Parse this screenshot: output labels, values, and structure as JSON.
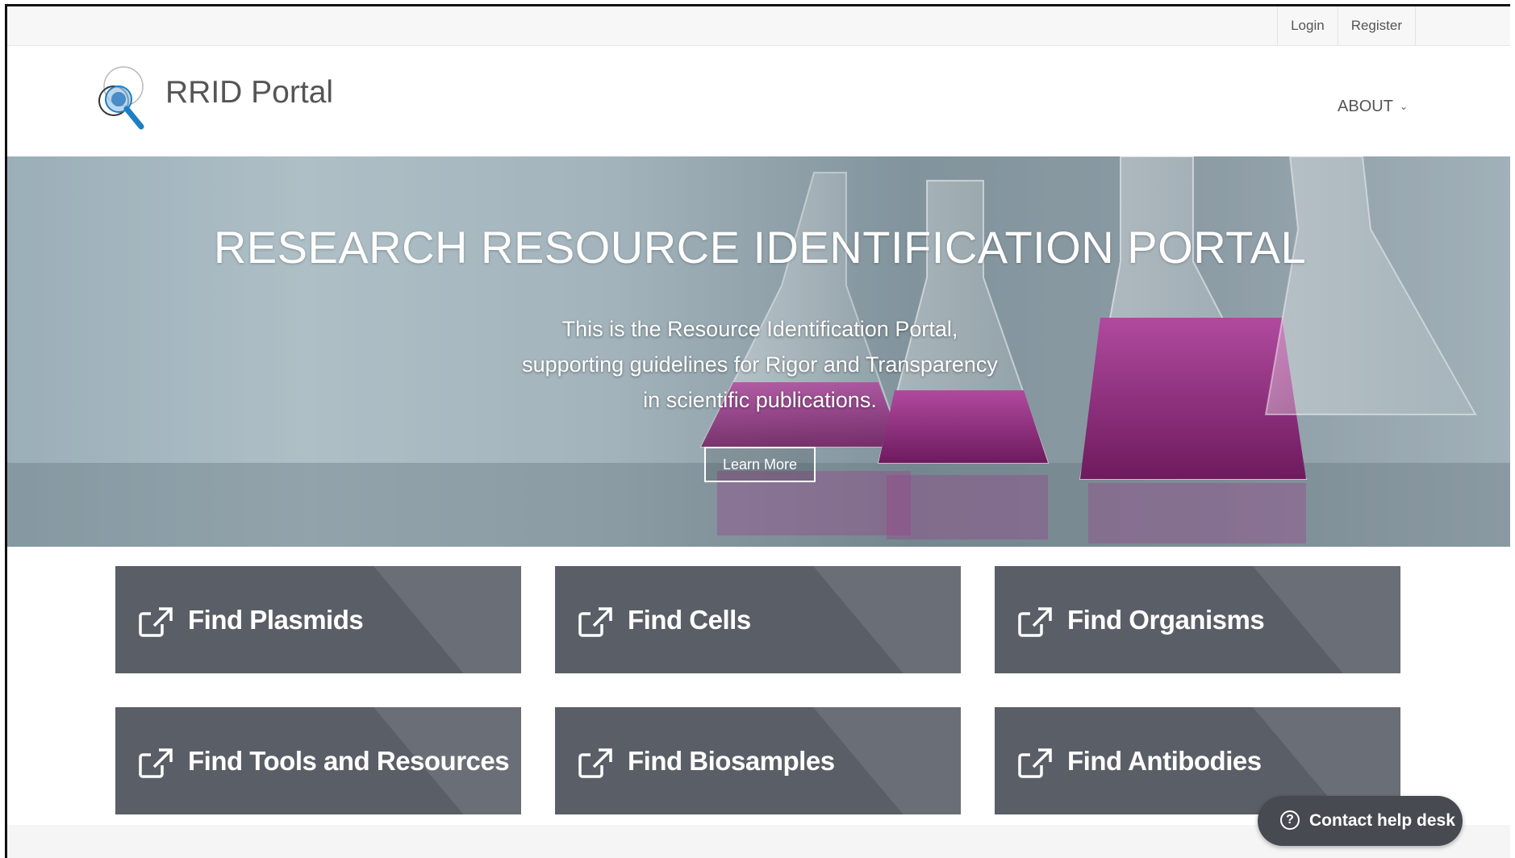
{
  "topbar": {
    "login": "Login",
    "register": "Register"
  },
  "header": {
    "brand": "RRID Portal",
    "about": "ABOUT",
    "about_chevron": "chevron-down-icon"
  },
  "hero": {
    "title": "RESEARCH RESOURCE IDENTIFICATION PORTAL",
    "subtitle_lines": [
      "This is the Resource Identification Portal,",
      "supporting guidelines for Rigor and Transparency",
      "in scientific publications."
    ],
    "button": "Learn More"
  },
  "cards": [
    {
      "label": "Find Plasmids",
      "icon": "external-link-icon"
    },
    {
      "label": "Find Cells",
      "icon": "external-link-icon"
    },
    {
      "label": "Find Organisms",
      "icon": "external-link-icon"
    },
    {
      "label": "Find Tools and Resources",
      "icon": "external-link-icon"
    },
    {
      "label": "Find Biosamples",
      "icon": "external-link-icon"
    },
    {
      "label": "Find Antibodies",
      "icon": "external-link-icon"
    }
  ],
  "helpdesk": {
    "label": "Contact help desk",
    "icon": "question-circle-icon"
  },
  "colors": {
    "card_bg": "#5a5e66",
    "helpdesk_bg": "#474a50",
    "brand_text": "#555555"
  }
}
